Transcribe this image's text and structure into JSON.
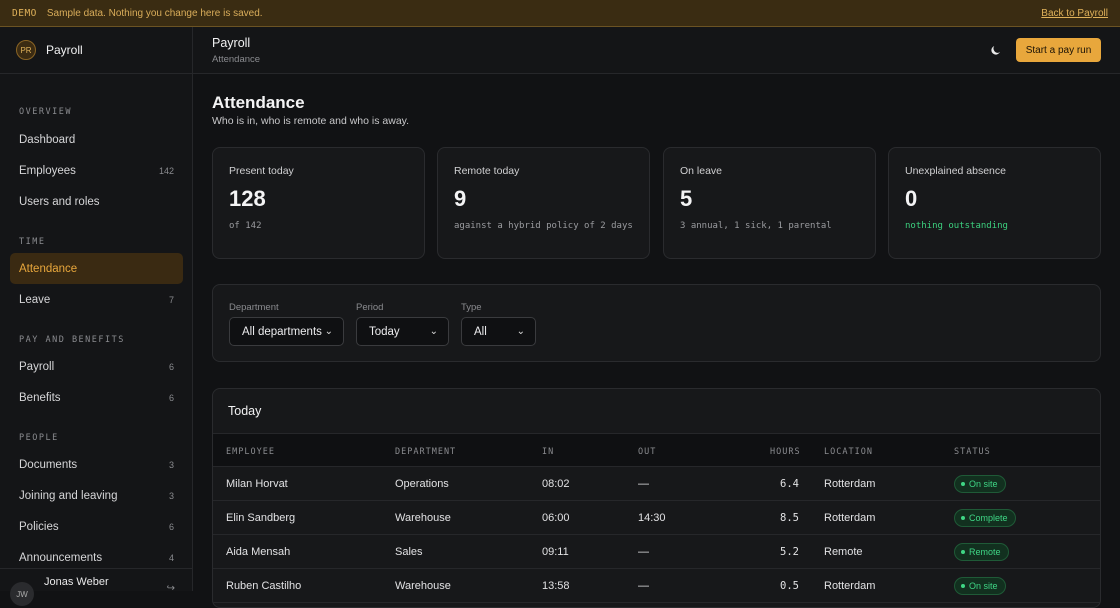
{
  "demo": {
    "tag": "DEMO",
    "message": "Sample data. Nothing you change here is saved.",
    "back_link": "Back to Payroll"
  },
  "brand": {
    "initials": "PR",
    "name": "Payroll"
  },
  "nav": {
    "sections": [
      {
        "title": "OVERVIEW",
        "items": [
          {
            "label": "Dashboard",
            "count": ""
          },
          {
            "label": "Employees",
            "count": "142"
          },
          {
            "label": "Users and roles",
            "count": ""
          }
        ]
      },
      {
        "title": "TIME",
        "items": [
          {
            "label": "Attendance",
            "count": ""
          },
          {
            "label": "Leave",
            "count": "7"
          }
        ]
      },
      {
        "title": "PAY AND BENEFITS",
        "items": [
          {
            "label": "Payroll",
            "count": "6"
          },
          {
            "label": "Benefits",
            "count": "6"
          }
        ]
      },
      {
        "title": "PEOPLE",
        "items": [
          {
            "label": "Documents",
            "count": "3"
          },
          {
            "label": "Joining and leaving",
            "count": "3"
          },
          {
            "label": "Policies",
            "count": "6"
          },
          {
            "label": "Announcements",
            "count": "4"
          }
        ]
      }
    ]
  },
  "user": {
    "initials": "JW",
    "name": "Jonas Weber",
    "action_icon": "sign-out-icon"
  },
  "header": {
    "title": "Payroll",
    "subtitle": "Attendance",
    "cta_label": "Start a pay run",
    "theme_icon": "moon-icon"
  },
  "page": {
    "title": "Attendance",
    "subtitle": "Who is in, who is remote and who is away."
  },
  "stats": [
    {
      "label": "Present today",
      "value": "128",
      "note": "of 142",
      "accent": false
    },
    {
      "label": "Remote today",
      "value": "9",
      "note": "against a hybrid policy of 2 days",
      "accent": false
    },
    {
      "label": "On leave",
      "value": "5",
      "note": "3 annual, 1 sick, 1 parental",
      "accent": false
    },
    {
      "label": "Unexplained absence",
      "value": "0",
      "note": "nothing outstanding",
      "accent": true
    }
  ],
  "filters": [
    {
      "label": "Department",
      "value": "All departments"
    },
    {
      "label": "Period",
      "value": "Today"
    },
    {
      "label": "Type",
      "value": "All"
    }
  ],
  "table": {
    "title": "Today",
    "columns": [
      "EMPLOYEE",
      "DEPARTMENT",
      "IN",
      "OUT",
      "HOURS",
      "LOCATION",
      "STATUS"
    ],
    "rows": [
      {
        "employee": "Milan Horvat",
        "department": "Operations",
        "in": "08:02",
        "out": "—",
        "hours": "6.4",
        "location": "Rotterdam",
        "status": "On site"
      },
      {
        "employee": "Elin Sandberg",
        "department": "Warehouse",
        "in": "06:00",
        "out": "14:30",
        "hours": "8.5",
        "location": "Rotterdam",
        "status": "Complete"
      },
      {
        "employee": "Aida Mensah",
        "department": "Sales",
        "in": "09:11",
        "out": "—",
        "hours": "5.2",
        "location": "Remote",
        "status": "Remote"
      },
      {
        "employee": "Ruben Castilho",
        "department": "Warehouse",
        "in": "13:58",
        "out": "—",
        "hours": "0.5",
        "location": "Rotterdam",
        "status": "On site"
      }
    ]
  },
  "colors": {
    "accent": "#e8a73c",
    "success": "#3fd685",
    "background": "#111214"
  }
}
